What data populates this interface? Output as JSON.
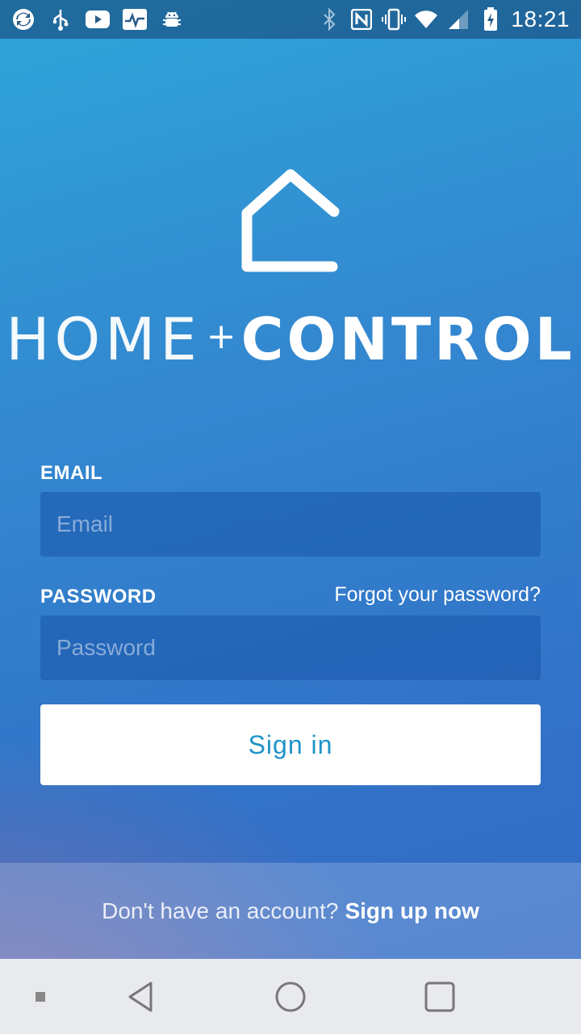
{
  "status_bar": {
    "time": "18:21",
    "left_icons": [
      "sync-app-icon",
      "usb-icon",
      "youtube-icon",
      "activity-monitor-icon",
      "android-debug-icon"
    ],
    "right_icons": [
      "bluetooth-icon",
      "nfc-icon",
      "vibrate-icon",
      "wifi-icon",
      "signal-icon",
      "battery-charging-icon"
    ]
  },
  "logo": {
    "icon": "house-outline-icon",
    "word_home": "HOME",
    "word_plus": "+",
    "word_control": "CONTROL"
  },
  "form": {
    "email_label": "EMAIL",
    "email_placeholder": "Email",
    "email_value": "",
    "password_label": "PASSWORD",
    "password_placeholder": "Password",
    "password_value": "",
    "forgot_link": "Forgot your password?",
    "signin_label": "Sign in"
  },
  "signup": {
    "prompt": "Don't have an account?",
    "link": "Sign up now"
  },
  "nav_bar": {
    "items": [
      "small-square-icon",
      "back-icon",
      "home-icon",
      "recents-icon"
    ]
  },
  "colors": {
    "gradient_top": "#2ea6d9",
    "gradient_bottom": "#3167c4",
    "accent_button_text": "#1e93c9",
    "nav_bar_bg": "#e8eaee"
  }
}
